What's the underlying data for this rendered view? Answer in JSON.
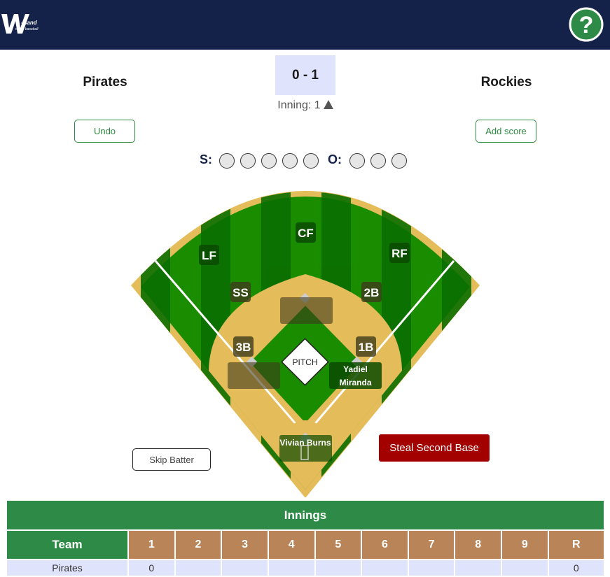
{
  "header": {
    "logo_text": "W",
    "logo_subtext": "minor baseball"
  },
  "score": {
    "home_team": "Pirates",
    "away_team": "Rockies",
    "score_text": "0 - 1",
    "inning_label": "Inning: 1"
  },
  "buttons": {
    "undo": "Undo",
    "add_score": "Add score",
    "skip_batter": "Skip Batter",
    "steal": "Steal Second Base"
  },
  "count": {
    "strikes_label": "S:",
    "outs_label": "O:",
    "strikes": 0,
    "outs": 0
  },
  "field": {
    "positions": {
      "cf": "CF",
      "lf": "LF",
      "rf": "RF",
      "ss": "SS",
      "second": "2B",
      "third": "3B",
      "first": "1B"
    },
    "pitch_label": "PITCH",
    "runner_first_line1": "Yadiel",
    "runner_first_line2": "Miranda",
    "batter": "Vivian Burns"
  },
  "innings_table": {
    "title": "Innings",
    "team_header": "Team",
    "columns": [
      "1",
      "2",
      "3",
      "4",
      "5",
      "6",
      "7",
      "8",
      "9",
      "R"
    ],
    "rows": [
      {
        "team": "Pirates",
        "cells": [
          "0",
          "",
          "",
          "",
          "",
          "",
          "",
          "",
          "",
          "0"
        ]
      }
    ]
  },
  "colors": {
    "navbar": "#14224a",
    "grass_light": "#1a8c00",
    "grass_dark": "#0a6e00",
    "dirt": "#e4bc5a",
    "table_header": "#2e8b47",
    "inning_header": "#b98458",
    "steal_button": "#a30000"
  }
}
